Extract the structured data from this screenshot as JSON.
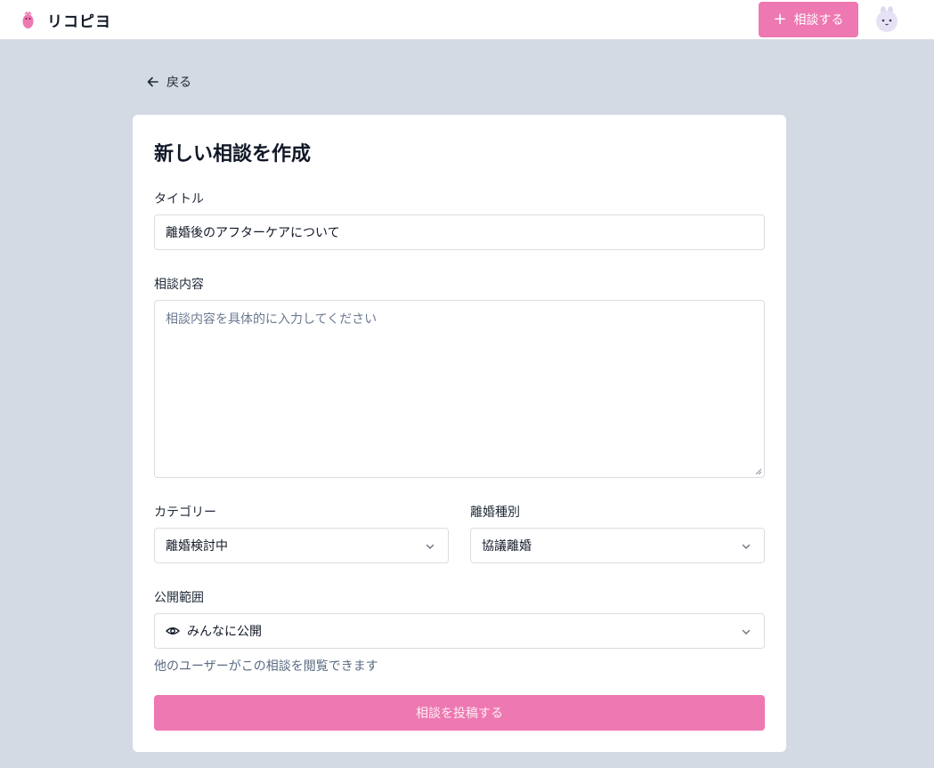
{
  "header": {
    "app_name": "リコピヨ",
    "new_button_label": "相談する",
    "logo_icon": "pink-chick-logo",
    "avatar_icon": "bunny-avatar"
  },
  "nav": {
    "back_label": "戻る"
  },
  "form": {
    "title": "新しい相談を作成",
    "title_label": "タイトル",
    "title_value": "離婚後のアフターケアについて",
    "content_label": "相談内容",
    "content_placeholder": "相談内容を具体的に入力してください",
    "category_label": "カテゴリー",
    "category_value": "離婚検討中",
    "divorce_type_label": "離婚種別",
    "divorce_type_value": "協議離婚",
    "visibility_label": "公開範囲",
    "visibility_value": "みんなに公開",
    "visibility_help": "他のユーザーがこの相談を閲覧できます",
    "submit_label": "相談を投稿する"
  },
  "colors": {
    "accent": "#ee78b1",
    "background": "#d4dae3",
    "card": "#ffffff"
  }
}
